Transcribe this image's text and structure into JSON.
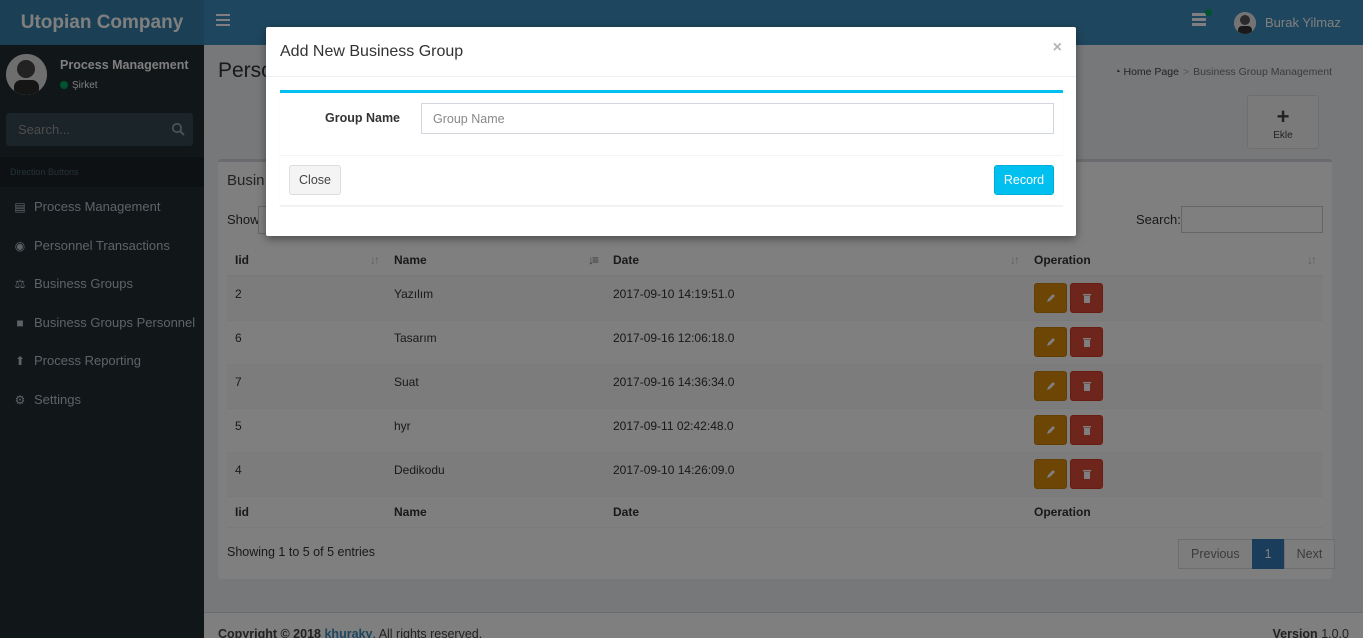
{
  "app": {
    "logo": "Utopian Company"
  },
  "header": {
    "user_name": "Burak Yilmaz"
  },
  "sidebar": {
    "panel_name": "Process Management",
    "panel_status": "Şirket",
    "search_placeholder": "Search...",
    "section_header": "Direction Buttons",
    "items": [
      {
        "label": "Process Management",
        "icon": "id-card-icon"
      },
      {
        "label": "Personnel Transactions",
        "icon": "location-pin-icon"
      },
      {
        "label": "Business Groups",
        "icon": "balance-scale-icon"
      },
      {
        "label": "Business Groups Personnel",
        "icon": "briefcase-icon"
      },
      {
        "label": "Process Reporting",
        "icon": "thumbtack-icon"
      },
      {
        "label": "Settings",
        "icon": "gear-icon"
      }
    ]
  },
  "content": {
    "page_title": "Perso",
    "breadcrumb": {
      "home": "Home Page",
      "current": "Business Group Management"
    },
    "add_button_label": "Ekle",
    "box_title": "Busin",
    "show_label": "Show",
    "search_label": "Search:",
    "table": {
      "columns": [
        "Iid",
        "Name",
        "Date",
        "Operation"
      ],
      "rows": [
        {
          "id": "2",
          "name": "Yazılım",
          "date": "2017-09-10 14:19:51.0"
        },
        {
          "id": "6",
          "name": "Tasarım",
          "date": "2017-09-16 12:06:18.0"
        },
        {
          "id": "7",
          "name": "Suat",
          "date": "2017-09-16 14:36:34.0"
        },
        {
          "id": "5",
          "name": "hyr",
          "date": "2017-09-11 02:42:48.0"
        },
        {
          "id": "4",
          "name": "Dedikodu",
          "date": "2017-09-10 14:26:09.0"
        }
      ]
    },
    "info": "Showing 1 to 5 of 5 entries",
    "pagination": {
      "previous": "Previous",
      "page": "1",
      "next": "Next"
    }
  },
  "footer": {
    "copyright_prefix": "Copyright © 2018",
    "author": "khuraky",
    "rights": ". All rights reserved.",
    "version_label": "Version",
    "version": "1.0.0"
  },
  "modal": {
    "title": "Add New Business Group",
    "close_symbol": "×",
    "field_label": "Group Name",
    "field_placeholder": "Group Name",
    "field_value": "",
    "close_button": "Close",
    "record_button": "Record"
  },
  "colors": {
    "header": "#3c8dbc",
    "logo_bg": "#367fa9",
    "sidebar": "#222d32",
    "edit": "#db8b0b",
    "delete": "#dd4b39",
    "record": "#00c0ef",
    "active_page": "#337ab7"
  }
}
